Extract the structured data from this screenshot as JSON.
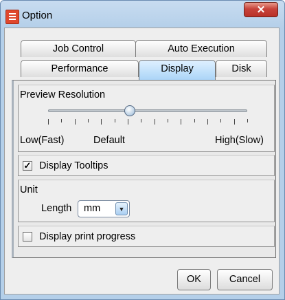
{
  "window": {
    "title": "Option",
    "close_glyph": "✕",
    "icon": "app-icon"
  },
  "tabs": {
    "row1": [
      "Job Control",
      "Auto Execution"
    ],
    "row2": [
      "Performance",
      "Display",
      "Disk"
    ],
    "active": "Display"
  },
  "preview_resolution": {
    "title": "Preview Resolution",
    "labels": {
      "low": "Low(Fast)",
      "default": "Default",
      "high": "High(Slow)"
    },
    "tick_count": 16,
    "value_fraction": 0.41
  },
  "display_tooltips": {
    "label": "Display Tooltips",
    "checked": true
  },
  "unit": {
    "title": "Unit",
    "length_label": "Length",
    "length_value": "mm",
    "arrow": "▼"
  },
  "display_print_progress": {
    "label": "Display print progress",
    "checked": false
  },
  "buttons": {
    "ok": "OK",
    "cancel": "Cancel"
  },
  "colors": {
    "active_tab": "#a9d4f7",
    "close_button": "#c7433b"
  }
}
